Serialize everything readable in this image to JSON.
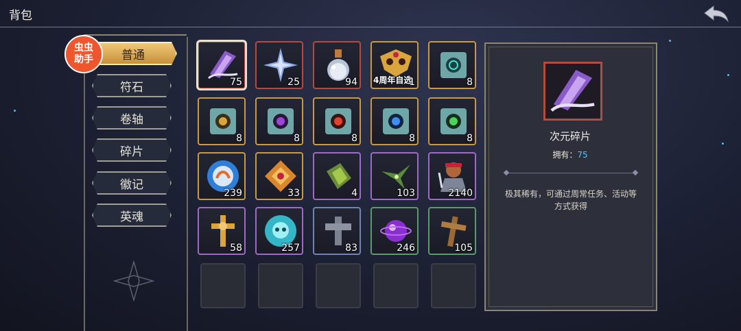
{
  "header": {
    "title": "背包"
  },
  "badge": {
    "line1": "虫虫",
    "line2": "助手"
  },
  "nav": {
    "items": [
      {
        "label": "普通",
        "active": true
      },
      {
        "label": "符石",
        "active": false
      },
      {
        "label": "卷轴",
        "active": false
      },
      {
        "label": "碎片",
        "active": false
      },
      {
        "label": "徽记",
        "active": false
      },
      {
        "label": "英魂",
        "active": false
      }
    ]
  },
  "grid": {
    "items": [
      {
        "icon": "crystal-shard-icon",
        "count": "75",
        "rarity": "red",
        "selected": true
      },
      {
        "icon": "silver-star-icon",
        "count": "25",
        "rarity": "red"
      },
      {
        "icon": "potion-flask-icon",
        "count": "94",
        "rarity": "red"
      },
      {
        "icon": "golden-mask-icon",
        "count": "1",
        "rarity": "gold",
        "tag": "4周年自选"
      },
      {
        "icon": "scroll-icon",
        "count": "8",
        "rarity": "gold"
      },
      {
        "icon": "scroll-icon",
        "count": "8",
        "rarity": "gold"
      },
      {
        "icon": "scroll-icon",
        "count": "8",
        "rarity": "gold"
      },
      {
        "icon": "scroll-icon",
        "count": "8",
        "rarity": "gold"
      },
      {
        "icon": "scroll-icon",
        "count": "8",
        "rarity": "gold"
      },
      {
        "icon": "scroll-icon",
        "count": "8",
        "rarity": "gold"
      },
      {
        "icon": "blue-medal-icon",
        "count": "239",
        "rarity": "gold"
      },
      {
        "icon": "golden-emblem-icon",
        "count": "33",
        "rarity": "gold"
      },
      {
        "icon": "green-crystal-icon",
        "count": "4",
        "rarity": "purple"
      },
      {
        "icon": "green-shuriken-icon",
        "count": "103",
        "rarity": "purple"
      },
      {
        "icon": "warrior-portrait-icon",
        "count": "2140",
        "rarity": "purple"
      },
      {
        "icon": "golden-cross-icon",
        "count": "58",
        "rarity": "purple"
      },
      {
        "icon": "cyan-skull-coin-icon",
        "count": "257",
        "rarity": "purple"
      },
      {
        "icon": "stone-cross-icon",
        "count": "83",
        "rarity": "blue"
      },
      {
        "icon": "purple-orb-icon",
        "count": "246",
        "rarity": "green"
      },
      {
        "icon": "wooden-cross-icon",
        "count": "105",
        "rarity": "green"
      }
    ],
    "empty_slots": 5
  },
  "detail": {
    "name": "次元碎片",
    "owned_label": "拥有：",
    "owned_value": "75",
    "description": "极其稀有，可通过周常任务、活动等方式获得"
  },
  "colors": {
    "accent_gold": "#c79a43",
    "rarity_red": "#b64a3f",
    "rarity_purple": "#9f6ac6",
    "owned_value": "#58c4ff"
  }
}
